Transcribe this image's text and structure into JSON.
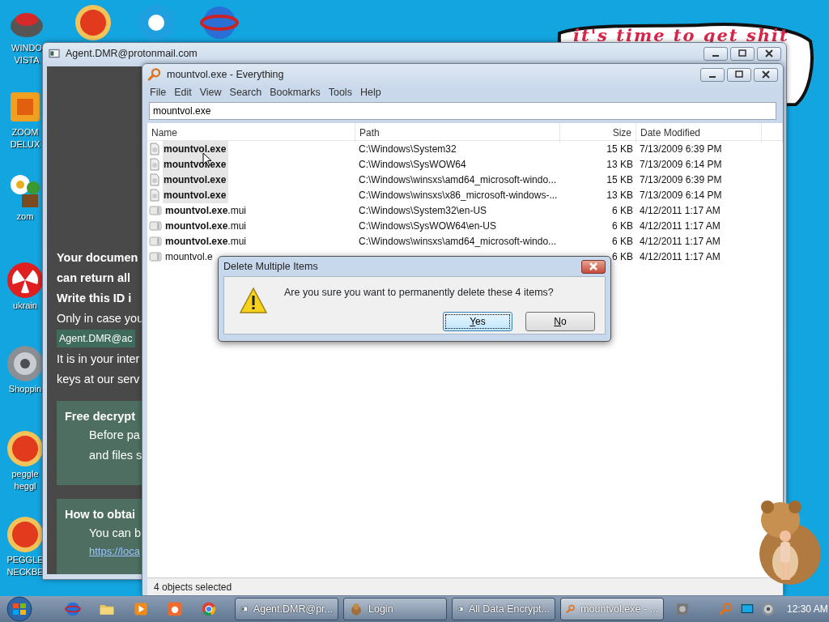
{
  "desktop": {
    "icons": [
      {
        "kind": "bowl",
        "label_lines": [
          "WINDO",
          "VISTA"
        ]
      },
      {
        "kind": "ball"
      },
      {
        "kind": "circle"
      },
      {
        "kind": "globe"
      },
      {
        "kind": "block",
        "label_lines": [
          "ZOOM",
          "DELUX"
        ]
      },
      {
        "kind": "flower",
        "label_lines": [
          "zom"
        ]
      },
      {
        "kind": "radiation",
        "label_lines": [
          "ukrain"
        ]
      },
      {
        "kind": "disc",
        "label_lines": [
          "Shoppin"
        ]
      },
      {
        "kind": "ball",
        "label_lines": [
          "peggle",
          "heggl"
        ]
      },
      {
        "kind": "ball",
        "label_lines": [
          "PEGGLE",
          "NECKBE"
        ]
      }
    ],
    "bubble": {
      "text": "it's time to get shit"
    }
  },
  "note_window": {
    "title": "Agent.DMR@protonmail.com",
    "lines": [
      {
        "kind": "bold",
        "text": "Your documen"
      },
      {
        "kind": "bold",
        "text": "can return all"
      },
      {
        "kind": "bold",
        "text": "Write this ID i"
      },
      {
        "kind": "plain",
        "text": "Only in case you"
      },
      {
        "kind": "email",
        "text": "Agent.DMR@ac"
      },
      {
        "kind": "plain",
        "text": "It is in your inter"
      },
      {
        "kind": "plain",
        "text": "keys at our serv"
      }
    ],
    "panels": [
      {
        "title": "Free decrypt",
        "lines": [
          "Before pa",
          "and files s"
        ]
      },
      {
        "title": "How to obtai",
        "lines": [
          "You can b"
        ],
        "link": "https://loca"
      }
    ]
  },
  "everything": {
    "title": "mountvol.exe - Everything",
    "menu": [
      "File",
      "Edit",
      "View",
      "Search",
      "Bookmarks",
      "Tools",
      "Help"
    ],
    "search": {
      "value": "mountvol.exe"
    },
    "columns": [
      "Name",
      "Path",
      "Size",
      "Date Modified"
    ],
    "rows": [
      {
        "kind": "exe",
        "name": "mountvol.exe",
        "path": "C:\\Windows\\System32",
        "size": "15 KB",
        "date": "7/13/2009 6:39 PM",
        "selected": true
      },
      {
        "kind": "exe",
        "name": "mountvol.exe",
        "path": "C:\\Windows\\SysWOW64",
        "size": "13 KB",
        "date": "7/13/2009 6:14 PM",
        "selected": true
      },
      {
        "kind": "exe",
        "name": "mountvol.exe",
        "path": "C:\\Windows\\winsxs\\amd64_microsoft-windo...",
        "size": "15 KB",
        "date": "7/13/2009 6:39 PM",
        "selected": true
      },
      {
        "kind": "exe",
        "name": "mountvol.exe",
        "path": "C:\\Windows\\winsxs\\x86_microsoft-windows-...",
        "size": "13 KB",
        "date": "7/13/2009 6:14 PM",
        "selected": true
      },
      {
        "kind": "mui",
        "name": "**mountvol.exe**.mui",
        "path": "C:\\Windows\\System32\\en-US",
        "size": "6 KB",
        "date": "4/12/2011 1:17 AM",
        "selected": false
      },
      {
        "kind": "mui",
        "name": "**mountvol.exe**.mui",
        "path": "C:\\Windows\\SysWOW64\\en-US",
        "size": "6 KB",
        "date": "4/12/2011 1:17 AM",
        "selected": false
      },
      {
        "kind": "mui",
        "name": "**mountvol.exe**.mui",
        "path": "C:\\Windows\\winsxs\\amd64_microsoft-windo...",
        "size": "6 KB",
        "date": "4/12/2011 1:17 AM",
        "selected": false
      },
      {
        "kind": "mui",
        "name": "mountvol.e",
        "size": "6 KB",
        "date": "4/12/2011 1:17 AM",
        "selected": false
      }
    ],
    "status": "4 objects selected"
  },
  "dialog": {
    "title": "Delete Multiple Items",
    "message": "Are you sure you want to permanently delete these 4 items?",
    "buttons": [
      {
        "label": "Yes",
        "default": true
      },
      {
        "label": "No",
        "default": false
      }
    ]
  },
  "taskbar": {
    "tasks": [
      {
        "label": "Agent.DMR@pr...",
        "selected": false
      },
      {
        "label": "Login",
        "selected": false
      },
      {
        "label": "All Data Encrypt...",
        "selected": false
      },
      {
        "label": "mountvol.exe - ...",
        "selected": true
      }
    ],
    "clock": "12:30 AM"
  }
}
